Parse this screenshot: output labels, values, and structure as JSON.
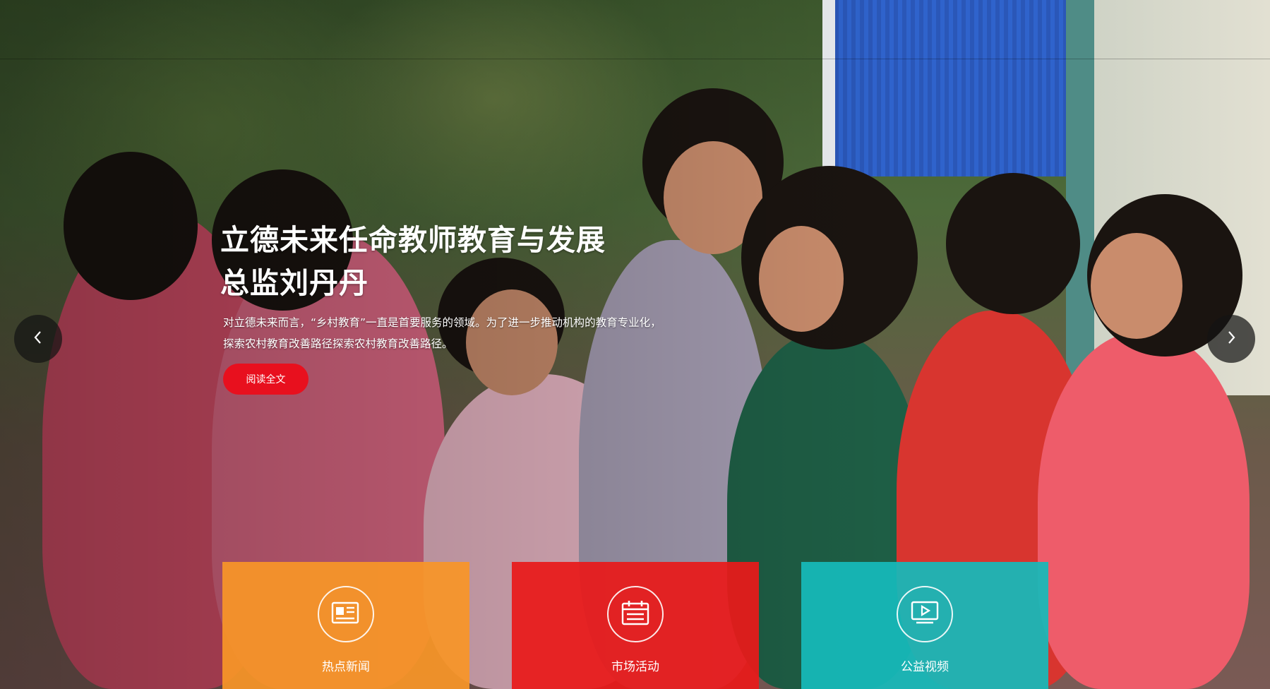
{
  "hero": {
    "title": "立德未来任命教师教育与发展\n总监刘丹丹",
    "description": "对立德未来而言，“乡村教育”一直是首要服务的领域。为了进一步推动机构的教育专业化，\n探索农村教育改善路径探索农村教育改善路径。",
    "read_more_label": "阅读全文"
  },
  "carousel": {
    "prev_icon": "chevron-left-icon",
    "next_icon": "chevron-right-icon"
  },
  "tiles": [
    {
      "label": "热点新闻",
      "icon": "newspaper-icon",
      "color": "#f7962a"
    },
    {
      "label": "市场活动",
      "icon": "calendar-icon",
      "color": "#e81a1a"
    },
    {
      "label": "公益视频",
      "icon": "video-play-icon",
      "color": "#16baba"
    }
  ],
  "colors": {
    "accent": "#e8101e"
  }
}
